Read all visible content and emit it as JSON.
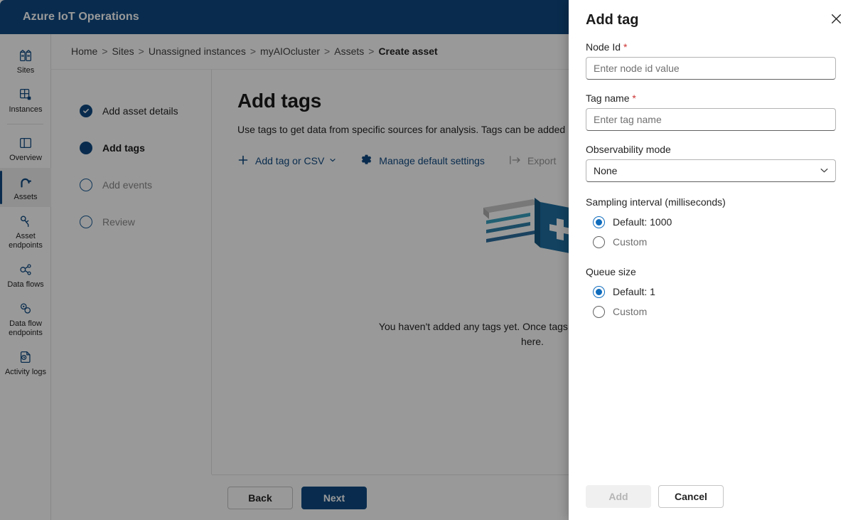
{
  "app": {
    "title": "Azure IoT Operations",
    "brand_color": "#0f4a82"
  },
  "sidebar": {
    "items": [
      {
        "label": "Sites",
        "icon": "sites-icon",
        "selected": false
      },
      {
        "label": "Instances",
        "icon": "instances-icon",
        "selected": false
      },
      {
        "label": "Overview",
        "icon": "overview-icon",
        "selected": false
      },
      {
        "label": "Assets",
        "icon": "assets-icon",
        "selected": true
      },
      {
        "label": "Asset endpoints",
        "icon": "asset-endpoints-icon",
        "selected": false
      },
      {
        "label": "Data flows",
        "icon": "data-flows-icon",
        "selected": false
      },
      {
        "label": "Data flow endpoints",
        "icon": "data-flow-endpoints-icon",
        "selected": false
      },
      {
        "label": "Activity logs",
        "icon": "activity-logs-icon",
        "selected": false
      }
    ]
  },
  "breadcrumb": {
    "items": [
      "Home",
      "Sites",
      "Unassigned instances",
      "myAIOcluster",
      "Assets"
    ],
    "current": "Create asset",
    "separator": ">"
  },
  "wizard": {
    "steps": [
      {
        "label": "Add asset details",
        "state": "done"
      },
      {
        "label": "Add tags",
        "state": "active"
      },
      {
        "label": "Add events",
        "state": "todo"
      },
      {
        "label": "Review",
        "state": "todo"
      }
    ]
  },
  "main": {
    "heading": "Add tags",
    "description": "Use tags to get data from specific sources for analysis. Tags can be added manually or by importing a CSV file.",
    "toolbar": {
      "add_tag_label": "Add tag or CSV",
      "manage_defaults_label": "Manage default settings",
      "export_label": "Export"
    },
    "empty_state": {
      "line1": "You haven't added any tags yet. Once tags are added, they'll",
      "line2": "show up here."
    }
  },
  "footer": {
    "back_label": "Back",
    "next_label": "Next"
  },
  "flyout": {
    "title": "Add tag",
    "node_id": {
      "label": "Node Id",
      "required_marker": "*",
      "placeholder": "Enter node id value",
      "value": ""
    },
    "tag_name": {
      "label": "Tag name",
      "required_marker": "*",
      "placeholder": "Enter tag name",
      "value": ""
    },
    "observability_mode": {
      "label": "Observability mode",
      "selected": "None"
    },
    "sampling_interval": {
      "label": "Sampling interval (milliseconds)",
      "options": [
        {
          "label": "Default: 1000",
          "checked": true
        },
        {
          "label": "Custom",
          "checked": false
        }
      ]
    },
    "queue_size": {
      "label": "Queue size",
      "options": [
        {
          "label": "Default: 1",
          "checked": true
        },
        {
          "label": "Custom",
          "checked": false
        }
      ]
    },
    "actions": {
      "add_label": "Add",
      "cancel_label": "Cancel"
    }
  }
}
